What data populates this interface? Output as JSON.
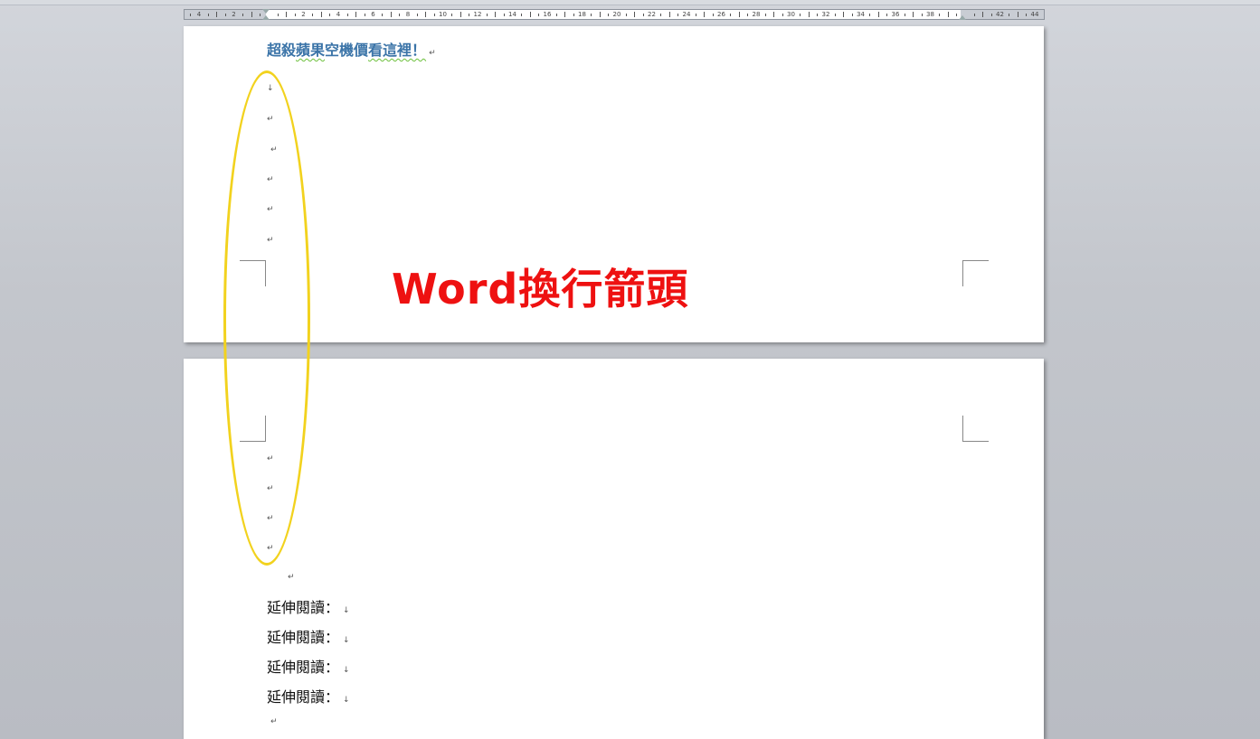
{
  "ruler": {
    "numbers": [
      "4",
      "2",
      "",
      "2",
      "4",
      "6",
      "8",
      "10",
      "12",
      "14",
      "16",
      "18",
      "20",
      "22",
      "24",
      "26",
      "28",
      "30",
      "32",
      "34",
      "36",
      "38",
      "",
      "42",
      "44"
    ]
  },
  "page1": {
    "heading_part1": "超殺",
    "heading_part2": "蘋果",
    "heading_part3": "空機價",
    "heading_part4": "看這裡！",
    "heading_mark": "↵",
    "line_break_symbol": "↓",
    "paragraph_symbol": "↵"
  },
  "annotation": {
    "text": "Word換行箭頭",
    "color": "#ee1111",
    "ellipse_color": "#f2d21e"
  },
  "page2": {
    "paragraph_symbol": "↵",
    "line_break_symbol": "↓",
    "reading_items": [
      {
        "label": "延伸閱讀：",
        "mark": "↓"
      },
      {
        "label": "延伸閱讀：",
        "mark": "↓"
      },
      {
        "label": "延伸閱讀：",
        "mark": "↓"
      },
      {
        "label": "延伸閱讀：",
        "mark": "↓"
      }
    ]
  }
}
